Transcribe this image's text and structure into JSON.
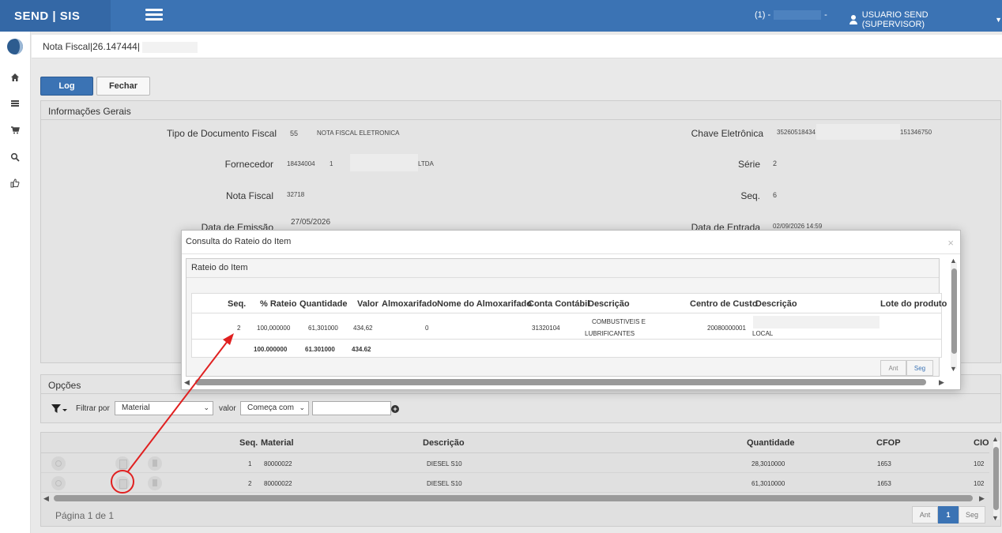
{
  "brand": "SEND | SIS",
  "topbar": {
    "notifications": "(1) -",
    "notifications_trail": "-",
    "user": "USUARIO SEND (SUPERVISOR)"
  },
  "sidebar": {
    "items": [
      "home-icon",
      "list-icon",
      "cart-icon",
      "search-icon",
      "thumbs-up-icon"
    ]
  },
  "breadcrumb": "Nota Fiscal|26.147444|",
  "buttons": {
    "log": "Log",
    "close": "Fechar"
  },
  "info": {
    "title": "Informações Gerais",
    "tipo_doc_label": "Tipo de Documento Fiscal",
    "tipo_doc_code": "55",
    "tipo_doc_desc": "NOTA FISCAL ELETRONICA",
    "fornecedor_label": "Fornecedor",
    "fornecedor_code": "18434004",
    "fornecedor_num": "1",
    "fornecedor_suffix": "LTDA",
    "nota_label": "Nota Fiscal",
    "nota_value": "32718",
    "emissao_label": "Data de Emissão",
    "emissao_value": "27/05/2026",
    "chave_label": "Chave Eletrônica",
    "chave_start": "35260518434",
    "chave_end": "151346750",
    "serie_label": "Série",
    "serie_value": "2",
    "seq_label": "Seq.",
    "seq_value": "6",
    "entrada_label": "Data de Entrada",
    "entrada_value": "02/09/2026 14:59"
  },
  "options": {
    "title": "Opções",
    "filter_label": "Filtrar por",
    "filter_value": "Material",
    "valor_label": "valor",
    "match_value": "Começa com"
  },
  "grid": {
    "headers": {
      "seq": "Seq.",
      "material": "Material",
      "descricao": "Descrição",
      "quantidade": "Quantidade",
      "cfop": "CFOP",
      "cio": "CIO"
    },
    "rows": [
      {
        "seq": "1",
        "material": "80000022",
        "descricao": "DIESEL S10",
        "quantidade": "28,3010000",
        "cfop": "1653",
        "cio": "102"
      },
      {
        "seq": "2",
        "material": "80000022",
        "descricao": "DIESEL S10",
        "quantidade": "61,3010000",
        "cfop": "1653",
        "cio": "102"
      }
    ],
    "page_info": "Página 1 de 1",
    "pager": {
      "prev": "Ant",
      "current": "1",
      "next": "Seg"
    }
  },
  "modal": {
    "title": "Consulta do Rateio do Item",
    "close": "×",
    "section_title": "Rateio do Item",
    "headers": {
      "seq": "Seq.",
      "rateio": "% Rateio",
      "quantidade": "Quantidade",
      "valor": "Valor",
      "almoxarifado": "Almoxarifado",
      "nome_almox": "Nome do Almoxarifado",
      "conta": "Conta Contábil",
      "descricao": "Descrição",
      "centro": "Centro de Custo",
      "descricao2": "Descrição",
      "lote": "Lote do produto"
    },
    "row": {
      "seq": "2",
      "rateio": "100,000000",
      "quantidade": "61,301000",
      "valor": "434,62",
      "almoxarifado": "0",
      "conta": "31320104",
      "descricao_1": "COMBUSTIVEIS E",
      "descricao_2": "LUBRIFICANTES",
      "centro": "20080000001",
      "descricao2": "LOCAL"
    },
    "totals": {
      "rateio": "100.000000",
      "quantidade": "61.301000",
      "valor": "434.62"
    },
    "pager": {
      "prev": "Ant",
      "next": "Seg"
    }
  },
  "colors": {
    "primary": "#3b73b4",
    "highlight": "#e02020"
  }
}
